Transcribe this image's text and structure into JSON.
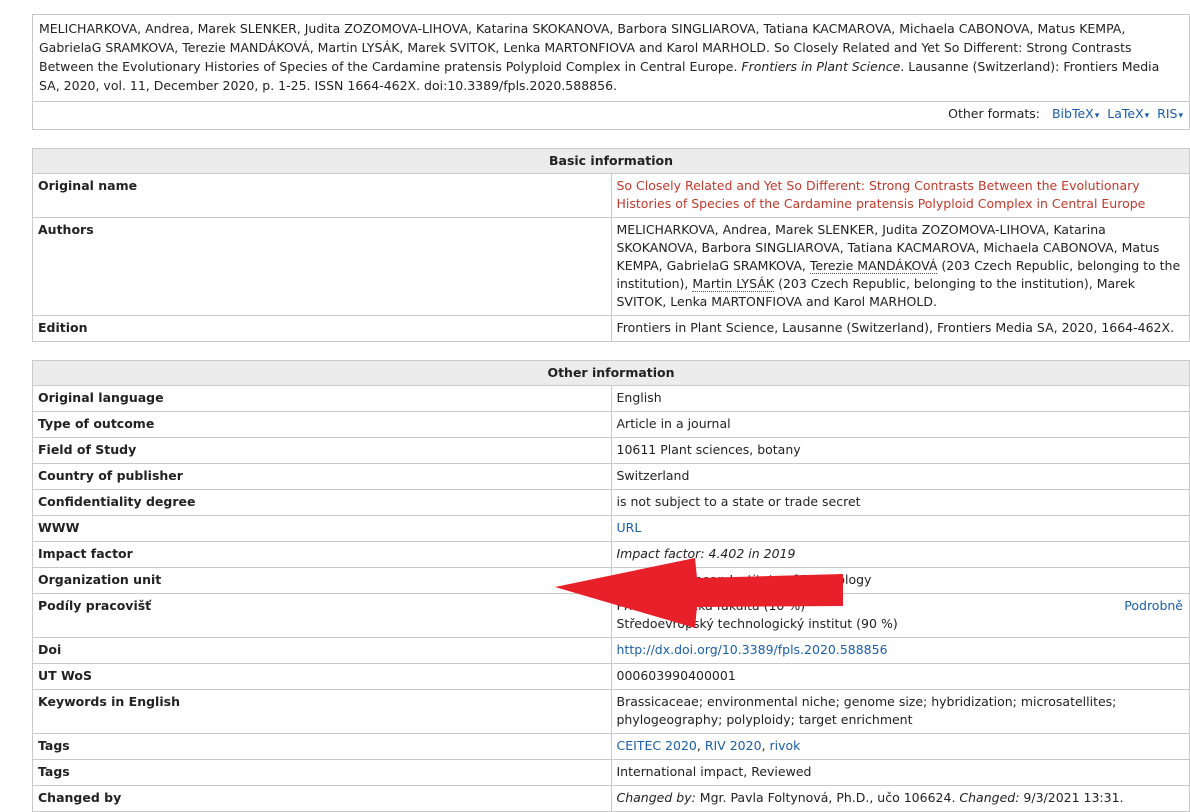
{
  "citation": {
    "text_before": "MELICHARKOVA, Andrea, Marek SLENKER, Judita ZOZOMOVA-LIHOVA, Katarina SKOKANOVA, Barbora SINGLIAROVA, Tatiana KACMAROVA, Michaela CABONOVA, Matus KEMPA, GabrielaG SRAMKOVA, Terezie MANDÁKOVÁ, Martin LYSÁK, Marek SVITOK, Lenka MARTONFIOVA and Karol MARHOLD. So Closely Related and Yet So Different: Strong Contrasts Between the Evolutionary Histories of Species of the Cardamine pratensis Polyploid Complex in Central Europe.",
    "journal": "Frontiers in Plant Science",
    "text_after": ". Lausanne (Switzerland): Frontiers Media SA, 2020, vol. 11, December 2020, p. 1-25. ISSN 1664-462X. doi:10.3389/fpls.2020.588856.",
    "formats_label": "Other formats:",
    "formats": [
      "BibTeX",
      "LaTeX",
      "RIS"
    ],
    "caret": "▾"
  },
  "basic": {
    "header": "Basic information",
    "original_name_label": "Original name",
    "original_name": "So Closely Related and Yet So Different: Strong Contrasts Between the Evolutionary Histories of Species of the Cardamine pratensis Polyploid Complex in Central Europe",
    "authors_label": "Authors",
    "authors_part1": "MELICHARKOVA, Andrea, Marek SLENKER, Judita ZOZOMOVA-LIHOVA, Katarina SKOKANOVA, Barbora SINGLIAROVA, Tatiana KACMAROVA, Michaela CABONOVA, Matus KEMPA, GabrielaG SRAMKOVA,",
    "author_link1": "Terezie MANDÁKOVÁ",
    "authors_part2": "(203 Czech Republic, belonging to the institution),",
    "author_link2": "Martin LYSÁK",
    "authors_part3": "(203 Czech Republic, belonging to the institution), Marek SVITOK, Lenka MARTONFIOVA and Karol MARHOLD.",
    "edition_label": "Edition",
    "edition": "Frontiers in Plant Science, Lausanne (Switzerland), Frontiers Media SA, 2020, 1664-462X."
  },
  "other": {
    "header": "Other information",
    "rows": {
      "language": {
        "label": "Original language",
        "value": "English"
      },
      "outcome": {
        "label": "Type of outcome",
        "value": "Article in a journal"
      },
      "field": {
        "label": "Field of Study",
        "value": "10611 Plant sciences, botany"
      },
      "country": {
        "label": "Country of publisher",
        "value": "Switzerland"
      },
      "confidentiality": {
        "label": "Confidentiality degree",
        "value": "is not subject to a state or trade secret"
      },
      "www": {
        "label": "WWW",
        "value": "URL"
      },
      "impact": {
        "label": "Impact factor",
        "value": "Impact factor: 4.402 in 2019"
      },
      "org_unit": {
        "label": "Organization unit",
        "value": "Central European Institute of Technology"
      },
      "shares": {
        "label": "Podíly pracovišť",
        "line1": "Přírodovědecká fakulta (10 %)",
        "line2": "Středoevropský technologický institut (90 %)",
        "details": "Podrobně"
      },
      "doi": {
        "label": "Doi",
        "value": "http://dx.doi.org/10.3389/fpls.2020.588856"
      },
      "utwos": {
        "label": "UT WoS",
        "value": "000603990400001"
      },
      "keywords": {
        "label": "Keywords in English",
        "value": "Brassicaceae; environmental niche; genome size; hybridization; microsatellites; phylogeography; polyploidy; target enrichment"
      },
      "tags1": {
        "label": "Tags",
        "links": [
          "CEITEC 2020",
          "RIV 2020",
          "rivok"
        ]
      },
      "tags2": {
        "label": "Tags",
        "value": "International impact, Reviewed"
      },
      "changed": {
        "label": "Changed by",
        "changed_by_label": "Changed by:",
        "changed_by": "Mgr. Pavla Foltynová, Ph.D., učo 106624.",
        "changed_label": "Changed:",
        "changed": "9/3/2021 13:31."
      }
    }
  },
  "colors": {
    "link": "#1a5ea8",
    "title": "#c0392b",
    "arrow": "#e8202a",
    "header_bg": "#ececec"
  },
  "annotation": {
    "icon": "red-arrow-icon"
  }
}
